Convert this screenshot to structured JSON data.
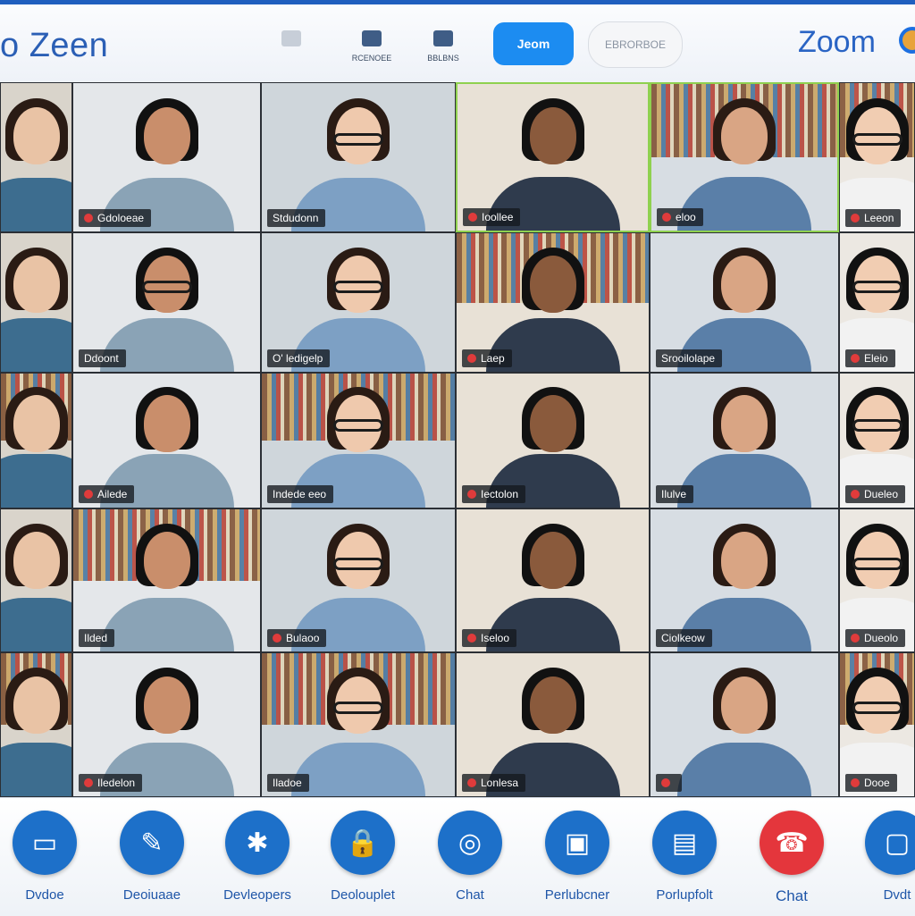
{
  "topbar": {
    "app_title": "o Zeen",
    "buttons": [
      {
        "label": "",
        "icon": "window-icon"
      },
      {
        "label": "RCENOEE",
        "icon": "book-icon"
      },
      {
        "label": "BBLBNS",
        "icon": "people-icon"
      }
    ],
    "primary_label": "Jeom",
    "secondary_label": "EBRORBOE",
    "brand": "Zoom"
  },
  "tiles": [
    {
      "name": "",
      "mic": false
    },
    {
      "name": "Gdoloeae",
      "mic": true
    },
    {
      "name": "Stdudonn",
      "mic": false
    },
    {
      "name": "Ioollee",
      "mic": true
    },
    {
      "name": "eloo",
      "mic": true
    },
    {
      "name": "Leeon",
      "mic": true
    },
    {
      "name": "",
      "mic": false
    },
    {
      "name": "Ddoont",
      "mic": false
    },
    {
      "name": "O' ledigelp",
      "mic": false
    },
    {
      "name": "Laep",
      "mic": true
    },
    {
      "name": "Srooilolape",
      "mic": false
    },
    {
      "name": "Eleio",
      "mic": true
    },
    {
      "name": "",
      "mic": false
    },
    {
      "name": "Ailede",
      "mic": true
    },
    {
      "name": "Indede eeo",
      "mic": false
    },
    {
      "name": "Iectolon",
      "mic": true
    },
    {
      "name": "Ilulve",
      "mic": false
    },
    {
      "name": "Dueleo",
      "mic": true
    },
    {
      "name": "",
      "mic": false
    },
    {
      "name": "Ilded",
      "mic": false
    },
    {
      "name": "Bulaoo",
      "mic": true
    },
    {
      "name": "Iseloo",
      "mic": true
    },
    {
      "name": "Ciolkeow",
      "mic": false
    },
    {
      "name": "Dueolo",
      "mic": true
    },
    {
      "name": "",
      "mic": false
    },
    {
      "name": "Iledelon",
      "mic": true
    },
    {
      "name": "Iladoe",
      "mic": false
    },
    {
      "name": "Lonlesa",
      "mic": true
    },
    {
      "name": "",
      "mic": true
    },
    {
      "name": "Dooe",
      "mic": true
    }
  ],
  "controls": [
    {
      "label": "Dvdoe",
      "icon": "video-icon"
    },
    {
      "label": "Deoiuaae",
      "icon": "mic-icon"
    },
    {
      "label": "Devleopers",
      "icon": "puzzle-icon"
    },
    {
      "label": "Deolouplet",
      "icon": "lock-icon"
    },
    {
      "label": "Chat",
      "icon": "chat-icon"
    },
    {
      "label": "Perlubcner",
      "icon": "share-screen-icon"
    },
    {
      "label": "Porlupfolt",
      "icon": "participants-icon"
    },
    {
      "label": "Chat",
      "icon": "end-call-icon"
    },
    {
      "label": "Dvdt",
      "icon": "more-icon"
    }
  ],
  "colors": {
    "accent": "#1c8cf1",
    "brand": "#2a64c4",
    "end_call": "#e4363c"
  }
}
